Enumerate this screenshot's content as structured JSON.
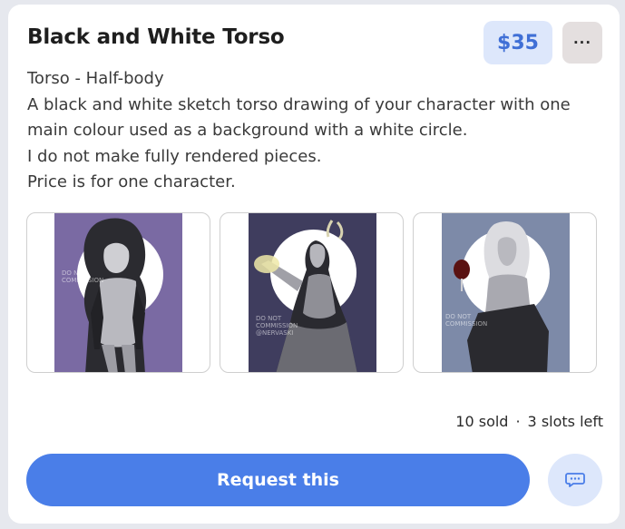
{
  "listing": {
    "title": "Black and White Torso",
    "price": "$35",
    "more_label": "···",
    "description": [
      "Torso - Half-body",
      "A black and white sketch torso drawing of your character with one",
      "main colour used as a background with a white circle.",
      "I do not make fully rendered pieces.",
      "Price is for one character."
    ],
    "gallery": [
      {
        "background": "#7a6aa3",
        "icon": "artwork-sample-icon"
      },
      {
        "background": "#3f3d5e",
        "icon": "artwork-sample-icon"
      },
      {
        "background": "#7d8aa8",
        "icon": "artwork-sample-icon"
      }
    ],
    "sold": "10 sold",
    "separator": "·",
    "slots": "3 slots left",
    "request_label": "Request this",
    "colors": {
      "accent": "#4a7ee8",
      "price_bg": "#dde7fb",
      "price_text": "#3f6fd6"
    }
  }
}
